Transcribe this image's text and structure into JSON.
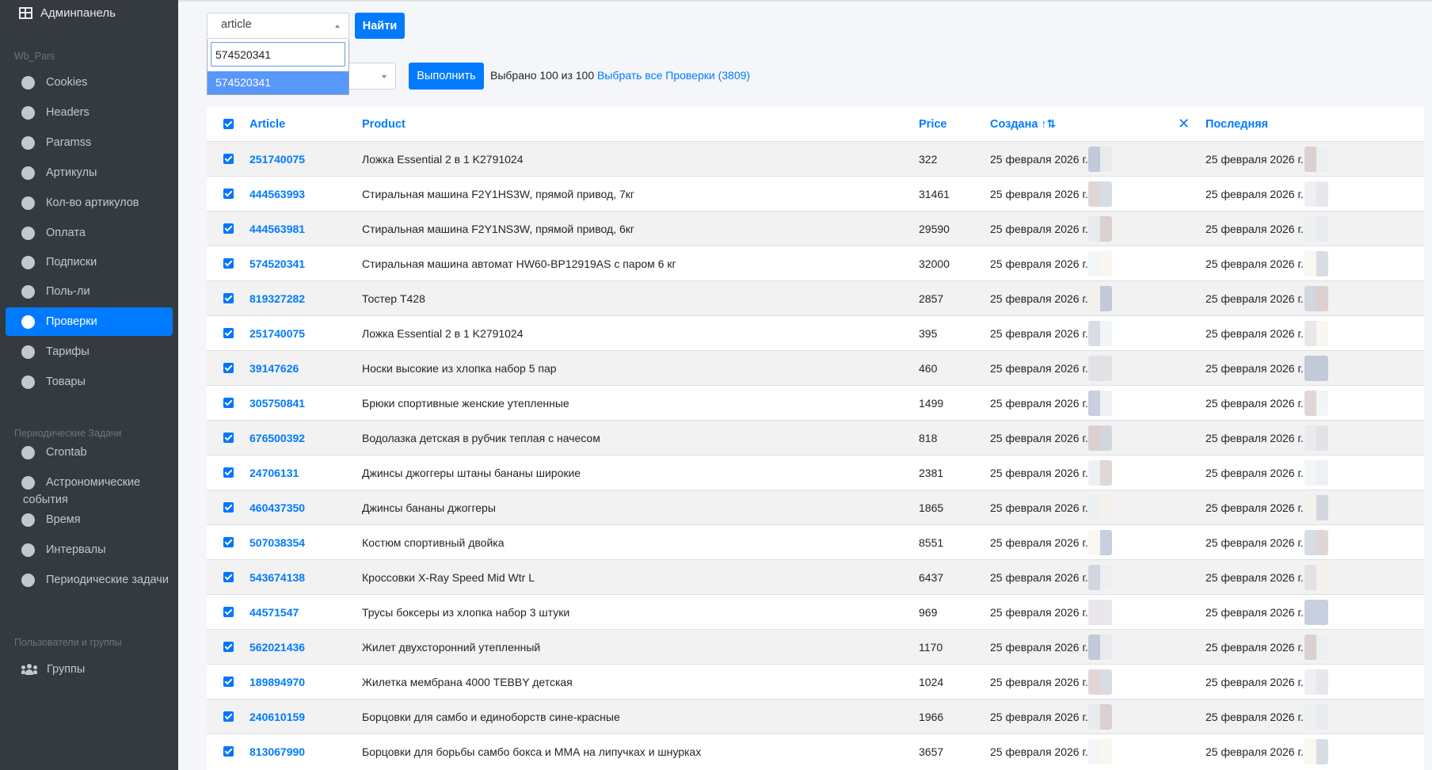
{
  "sidebar": {
    "brand": "Админпанель",
    "header_wb": "Wb_Pars",
    "items_wb": [
      "Cookies",
      "Headers",
      "Paramss",
      "Артикулы",
      "Кол-во артикулов",
      "Оплата",
      "Подписки",
      "Поль-ли",
      "Проверки",
      "Тарифы",
      "Товары"
    ],
    "active_item": "Проверки",
    "header_tasks": "Периодические Задачи",
    "items_tasks": [
      "Crontab",
      "Астрономические события",
      "Время",
      "Интервалы",
      "Периодические задачи"
    ],
    "header_users": "Пользователи и группы",
    "item_groups": "Группы"
  },
  "search": {
    "field_value": "article",
    "find_label": "Найти",
    "dropdown_input_value": "574520341",
    "dropdown_option": "574520341"
  },
  "actions": {
    "run_label": "Выполнить",
    "selected_text": "Выбрано 100 из 100",
    "select_all_link": "Выбрать все Проверки (3809)"
  },
  "table": {
    "headers": {
      "article": "Article",
      "product": "Product",
      "price": "Price",
      "created": "Создана",
      "created_sort_icon": "↑⇅",
      "clear_sort": "✕",
      "last": "Последняя"
    },
    "rows": [
      {
        "article": "251740075",
        "product": "Ложка Essential 2 в 1 K2791024",
        "price": "322",
        "created": "25 февраля 2026 г.",
        "last": "25 февраля 2026 г."
      },
      {
        "article": "444563993",
        "product": "Стиральная машина F2Y1HS3W, прямой привод, 7кг",
        "price": "31461",
        "created": "25 февраля 2026 г.",
        "last": "25 февраля 2026 г."
      },
      {
        "article": "444563981",
        "product": "Стиральная машина F2Y1NS3W, прямой привод, 6кг",
        "price": "29590",
        "created": "25 февраля 2026 г.",
        "last": "25 февраля 2026 г."
      },
      {
        "article": "574520341",
        "product": "Стиральная машина автомат HW60-BP12919AS с паром 6 кг",
        "price": "32000",
        "created": "25 февраля 2026 г.",
        "last": "25 февраля 2026 г."
      },
      {
        "article": "819327282",
        "product": "Тостер T428",
        "price": "2857",
        "created": "25 февраля 2026 г.",
        "last": "25 февраля 2026 г."
      },
      {
        "article": "251740075",
        "product": "Ложка Essential 2 в 1 K2791024",
        "price": "395",
        "created": "25 февраля 2026 г.",
        "last": "25 февраля 2026 г."
      },
      {
        "article": "39147626",
        "product": "Носки высокие из хлопка набор 5 пар",
        "price": "460",
        "created": "25 февраля 2026 г.",
        "last": "25 февраля 2026 г."
      },
      {
        "article": "305750841",
        "product": "Брюки спортивные женские утепленные",
        "price": "1499",
        "created": "25 февраля 2026 г.",
        "last": "25 февраля 2026 г."
      },
      {
        "article": "676500392",
        "product": "Водолазка детская в рубчик теплая с начесом",
        "price": "818",
        "created": "25 февраля 2026 г.",
        "last": "25 февраля 2026 г."
      },
      {
        "article": "24706131",
        "product": "Джинсы джоггеры штаны бананы широкие",
        "price": "2381",
        "created": "25 февраля 2026 г.",
        "last": "25 февраля 2026 г."
      },
      {
        "article": "460437350",
        "product": "Джинсы бананы джоггеры",
        "price": "1865",
        "created": "25 февраля 2026 г.",
        "last": "25 февраля 2026 г."
      },
      {
        "article": "507038354",
        "product": "Костюм спортивный двойка",
        "price": "8551",
        "created": "25 февраля 2026 г.",
        "last": "25 февраля 2026 г."
      },
      {
        "article": "543674138",
        "product": "Кроссовки X-Ray Speed Mid Wtr L",
        "price": "6437",
        "created": "25 февраля 2026 г.",
        "last": "25 февраля 2026 г."
      },
      {
        "article": "44571547",
        "product": "Трусы боксеры из хлопка набор 3 штуки",
        "price": "969",
        "created": "25 февраля 2026 г.",
        "last": "25 февраля 2026 г."
      },
      {
        "article": "562021436",
        "product": "Жилет двухсторонний утепленный",
        "price": "1170",
        "created": "25 февраля 2026 г.",
        "last": "25 февраля 2026 г."
      },
      {
        "article": "189894970",
        "product": "Жилетка мембрана 4000 TEBBY детская",
        "price": "1024",
        "created": "25 февраля 2026 г.",
        "last": "25 февраля 2026 г."
      },
      {
        "article": "240610159",
        "product": "Борцовки для самбо и единоборств сине-красные",
        "price": "1966",
        "created": "25 февраля 2026 г.",
        "last": "25 февраля 2026 г."
      },
      {
        "article": "813067990",
        "product": "Борцовки для борьбы самбо бокса и ММА на липучках и шнурках",
        "price": "3657",
        "created": "25 февраля 2026 г.",
        "last": "25 февраля 2026 г."
      }
    ]
  },
  "colors": {
    "sidebar_bg": "#343a40",
    "accent": "#007bff",
    "row_stripe": "#f2f2f2"
  }
}
